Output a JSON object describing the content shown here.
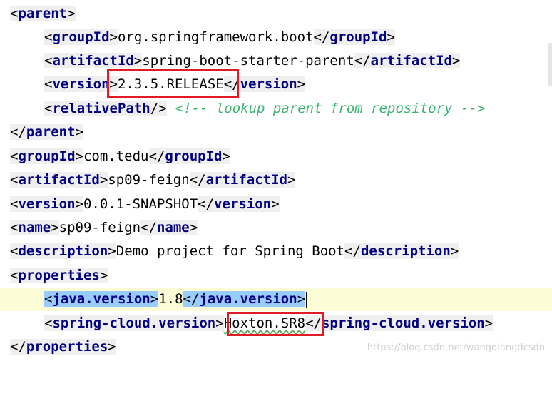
{
  "lines": [
    {
      "open": "parent"
    },
    {
      "open": "groupId",
      "text": "org.springframework.boot",
      "close": "groupId"
    },
    {
      "open": "artifactId",
      "text": "spring-boot-starter-parent",
      "close": "artifactId"
    },
    {
      "open": "version",
      "text": "2.3.5.RELEASE",
      "close": "version"
    },
    {
      "open": "relativePath",
      "comment": "<!-- lookup parent from repository -->"
    },
    {
      "close": "parent"
    },
    {
      "open": "groupId",
      "text": "com.tedu",
      "close": "groupId"
    },
    {
      "open": "artifactId",
      "text": "sp09-feign",
      "close": "artifactId"
    },
    {
      "open": "version",
      "text": "0.0.1-SNAPSHOT",
      "close": "version"
    },
    {
      "open": "name",
      "text": "sp09-feign",
      "close": "name"
    },
    {
      "open": "description",
      "text": "Demo project for Spring Boot",
      "close": "description"
    },
    {
      "open": "properties"
    },
    {
      "open": "java.version",
      "text": "1.8",
      "close": "java.version"
    },
    {
      "open": "spring-cloud.version",
      "text": "Hoxton.SR8",
      "close": "spring-cloud.version"
    },
    {
      "close": "properties"
    }
  ],
  "watermark": "https://blog.csdn.net/wangqiangdcsdn"
}
